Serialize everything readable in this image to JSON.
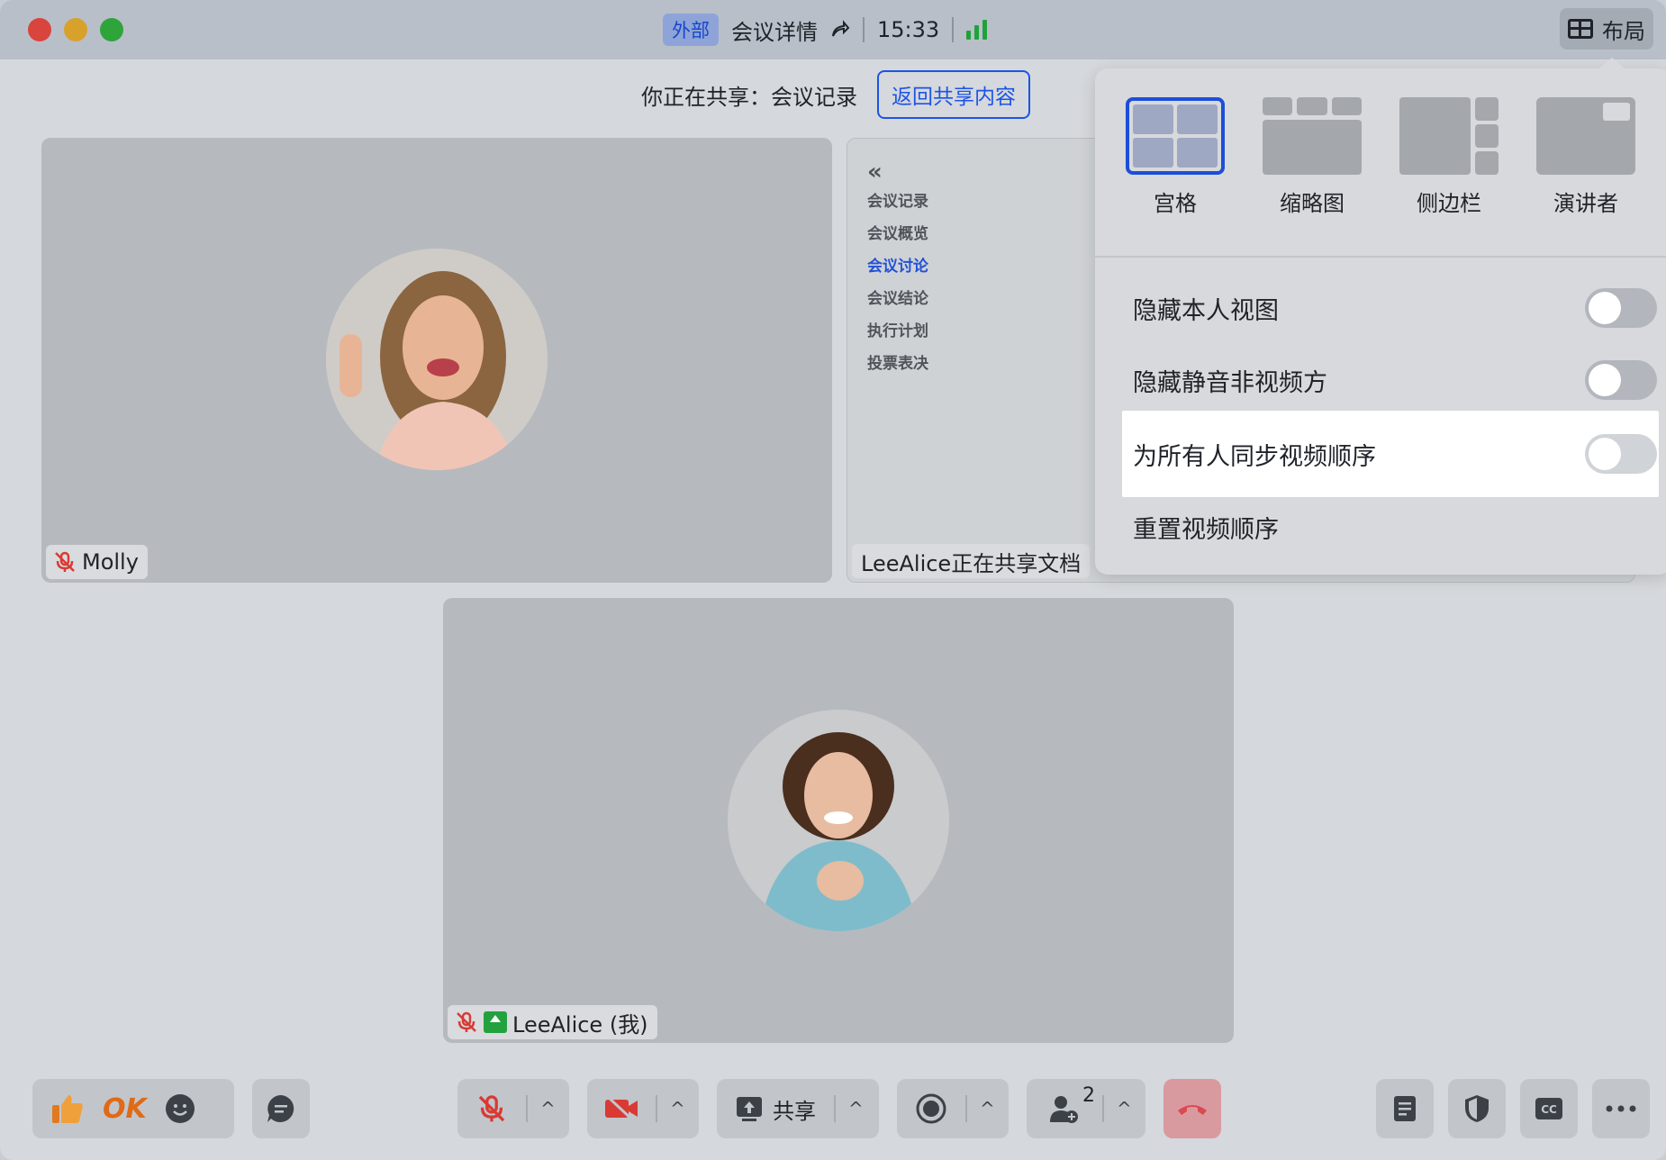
{
  "titlebar": {
    "badge": "外部",
    "title": "会议详情",
    "time": "15:33",
    "layout_label": "布局"
  },
  "share_bar": {
    "text": "你正在共享：会议记录",
    "back_button": "返回共享内容"
  },
  "participants": {
    "molly": "Molly",
    "self": "LeeAlice (我)"
  },
  "document": {
    "nav": [
      "会议记录",
      "会议概览",
      "会议讨论",
      "会议结论",
      "执行计划",
      "投票表决"
    ],
    "active_index": 2,
    "sharing_tag": "LeeAlice正在共享文档"
  },
  "layout_popover": {
    "options": [
      "宫格",
      "缩略图",
      "侧边栏",
      "演讲者"
    ],
    "selected": "宫格",
    "toggles": [
      {
        "label": "隐藏本人视图",
        "on": false
      },
      {
        "label": "隐藏静音非视频方",
        "on": false
      },
      {
        "label": "为所有人同步视频顺序",
        "on": false
      }
    ],
    "reset_label": "重置视频顺序"
  },
  "toolbar": {
    "ok_label": "OK",
    "share_label": "共享",
    "participant_count": "2"
  },
  "colors": {
    "accent": "#1d54e6",
    "signal": "#21a13a",
    "end_call": "#d94a52",
    "mic_off": "#d93a34"
  }
}
